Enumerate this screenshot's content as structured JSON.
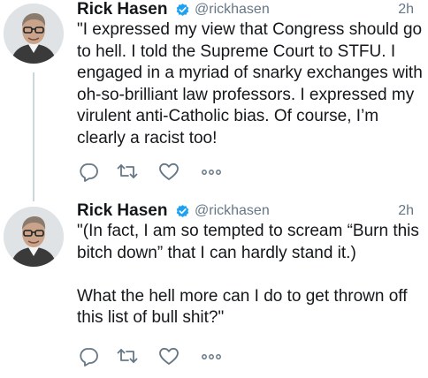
{
  "tweets": [
    {
      "author_name": "Rick Hasen",
      "handle": "@rickhasen",
      "time": "2h",
      "paragraphs": [
        "\"I expressed my view that Congress should go to hell. I told the Supreme Court to STFU. I engaged in a myriad of snarky exchanges with oh-so-brilliant law professors. I expressed my virulent anti-Catholic bias. Of course, I’m clearly a racist too!"
      ]
    },
    {
      "author_name": "Rick Hasen",
      "handle": "@rickhasen",
      "time": "2h",
      "paragraphs": [
        "\"(In fact, I am so tempted to scream “Burn this bitch down” that I can hardly stand it.)",
        "What the hell more can I do to get thrown off this list of bull shit?\""
      ]
    }
  ],
  "colors": {
    "text": "#14171a",
    "secondary": "#657786",
    "verified_badge": "#1da1f2",
    "action_icon": "#657786",
    "thread_line": "#ccd6dd"
  },
  "icons": [
    "verified-badge-icon",
    "reply-icon",
    "retweet-icon",
    "like-icon",
    "more-icon"
  ]
}
